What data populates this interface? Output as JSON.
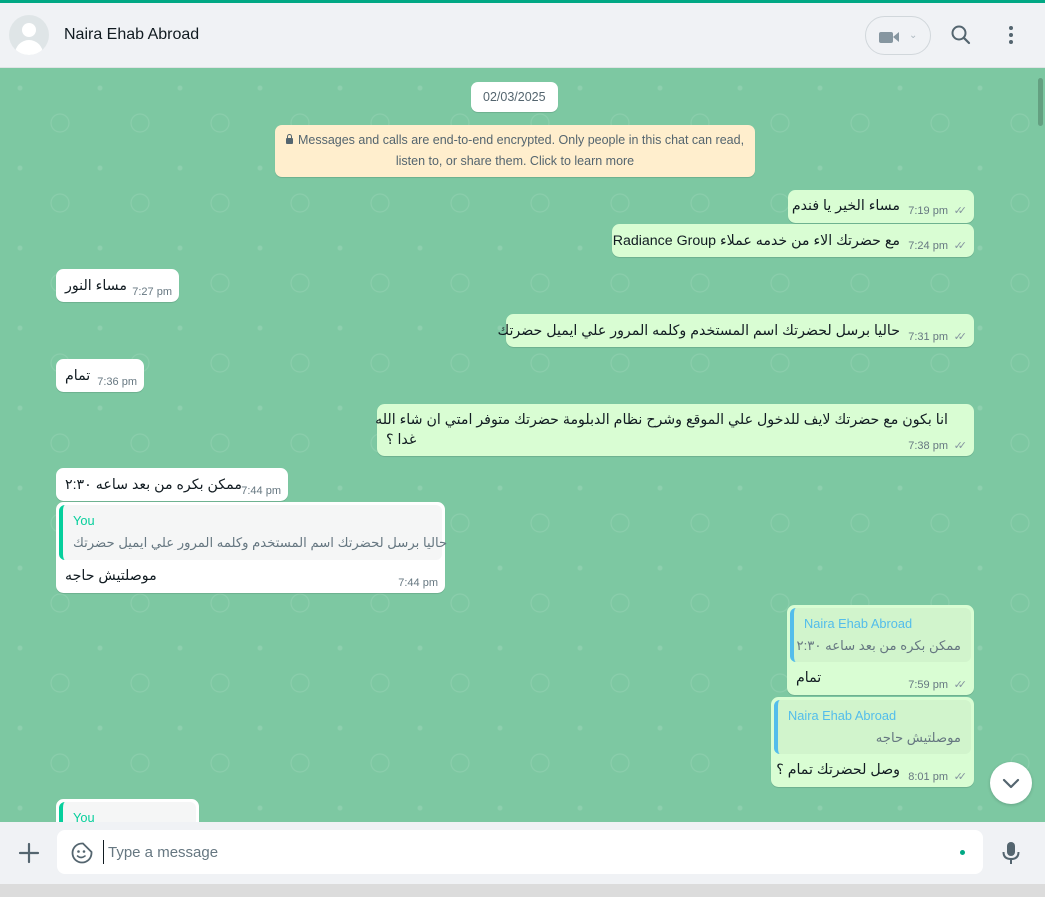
{
  "header": {
    "contact_name": "Naira Ehab Abroad"
  },
  "chat": {
    "date_chip": "02/03/2025",
    "encryption_line1": "Messages and calls are end-to-end encrypted. Only people in this chat can read,",
    "encryption_line2": "listen to, or share them. Click to learn more",
    "messages": [
      {
        "dir": "out",
        "text": "مساء الخير يا فندم",
        "time": "7:19 pm"
      },
      {
        "dir": "out",
        "text": "مع حضرتك الاء من خدمه عملاء Radiance Group",
        "time": "7:24 pm"
      },
      {
        "dir": "in",
        "text": "مساء النور",
        "time": "7:27 pm"
      },
      {
        "dir": "out",
        "text": "حاليا برسل لحضرتك اسم المستخدم وكلمه المرور علي ايميل حضرتك",
        "time": "7:31 pm"
      },
      {
        "dir": "in",
        "text": "تمام",
        "time": "7:36 pm"
      },
      {
        "dir": "out",
        "text_line1": "انا بكون مع حضرتك لايف للدخول علي الموقع وشرح نظام الدبلومة حضرتك متوفر امتي ان شاء الله",
        "text_line2": "غدا ؟",
        "time": "7:38 pm"
      },
      {
        "dir": "in",
        "text": "ممكن بكره من بعد ساعه ٢:٣٠",
        "time": "7:44 pm"
      },
      {
        "dir": "in",
        "quote_name": "You",
        "quote_text": "حاليا برسل لحضرتك اسم المستخدم وكلمه المرور علي ايميل حضرتك",
        "text": "موصلتيش حاجه",
        "time": "7:44 pm"
      },
      {
        "dir": "out",
        "quote_name": "Naira Ehab Abroad",
        "quote_text": "ممكن بكره من بعد ساعه ٢:٣٠",
        "text": "تمام",
        "time": "7:59 pm"
      },
      {
        "dir": "out",
        "quote_name": "Naira Ehab Abroad",
        "quote_text": "موصلتيش حاجه",
        "text": "وصل لحضرتك تمام ؟",
        "time": "8:01 pm"
      },
      {
        "dir": "in",
        "quote_name": "You"
      }
    ]
  },
  "composer": {
    "placeholder": "Type a message"
  },
  "colors": {
    "accent": "#00a884",
    "chat_background": "#7dc8a2",
    "outgoing_bubble": "#d9fdd3",
    "incoming_bubble": "#ffffff",
    "quote_bar_out": "#53bdeb",
    "quote_bar_in": "#06cf9c",
    "read_ticks": "#8696a0"
  },
  "icons": {
    "video": "video-camera-icon",
    "search": "search-icon",
    "menu": "kebab-menu-icon",
    "attach": "plus-icon",
    "emoji": "sticker-smiley-icon",
    "mic": "microphone-icon",
    "scroll": "chevron-down-icon",
    "ticks": "double-check-icon"
  }
}
